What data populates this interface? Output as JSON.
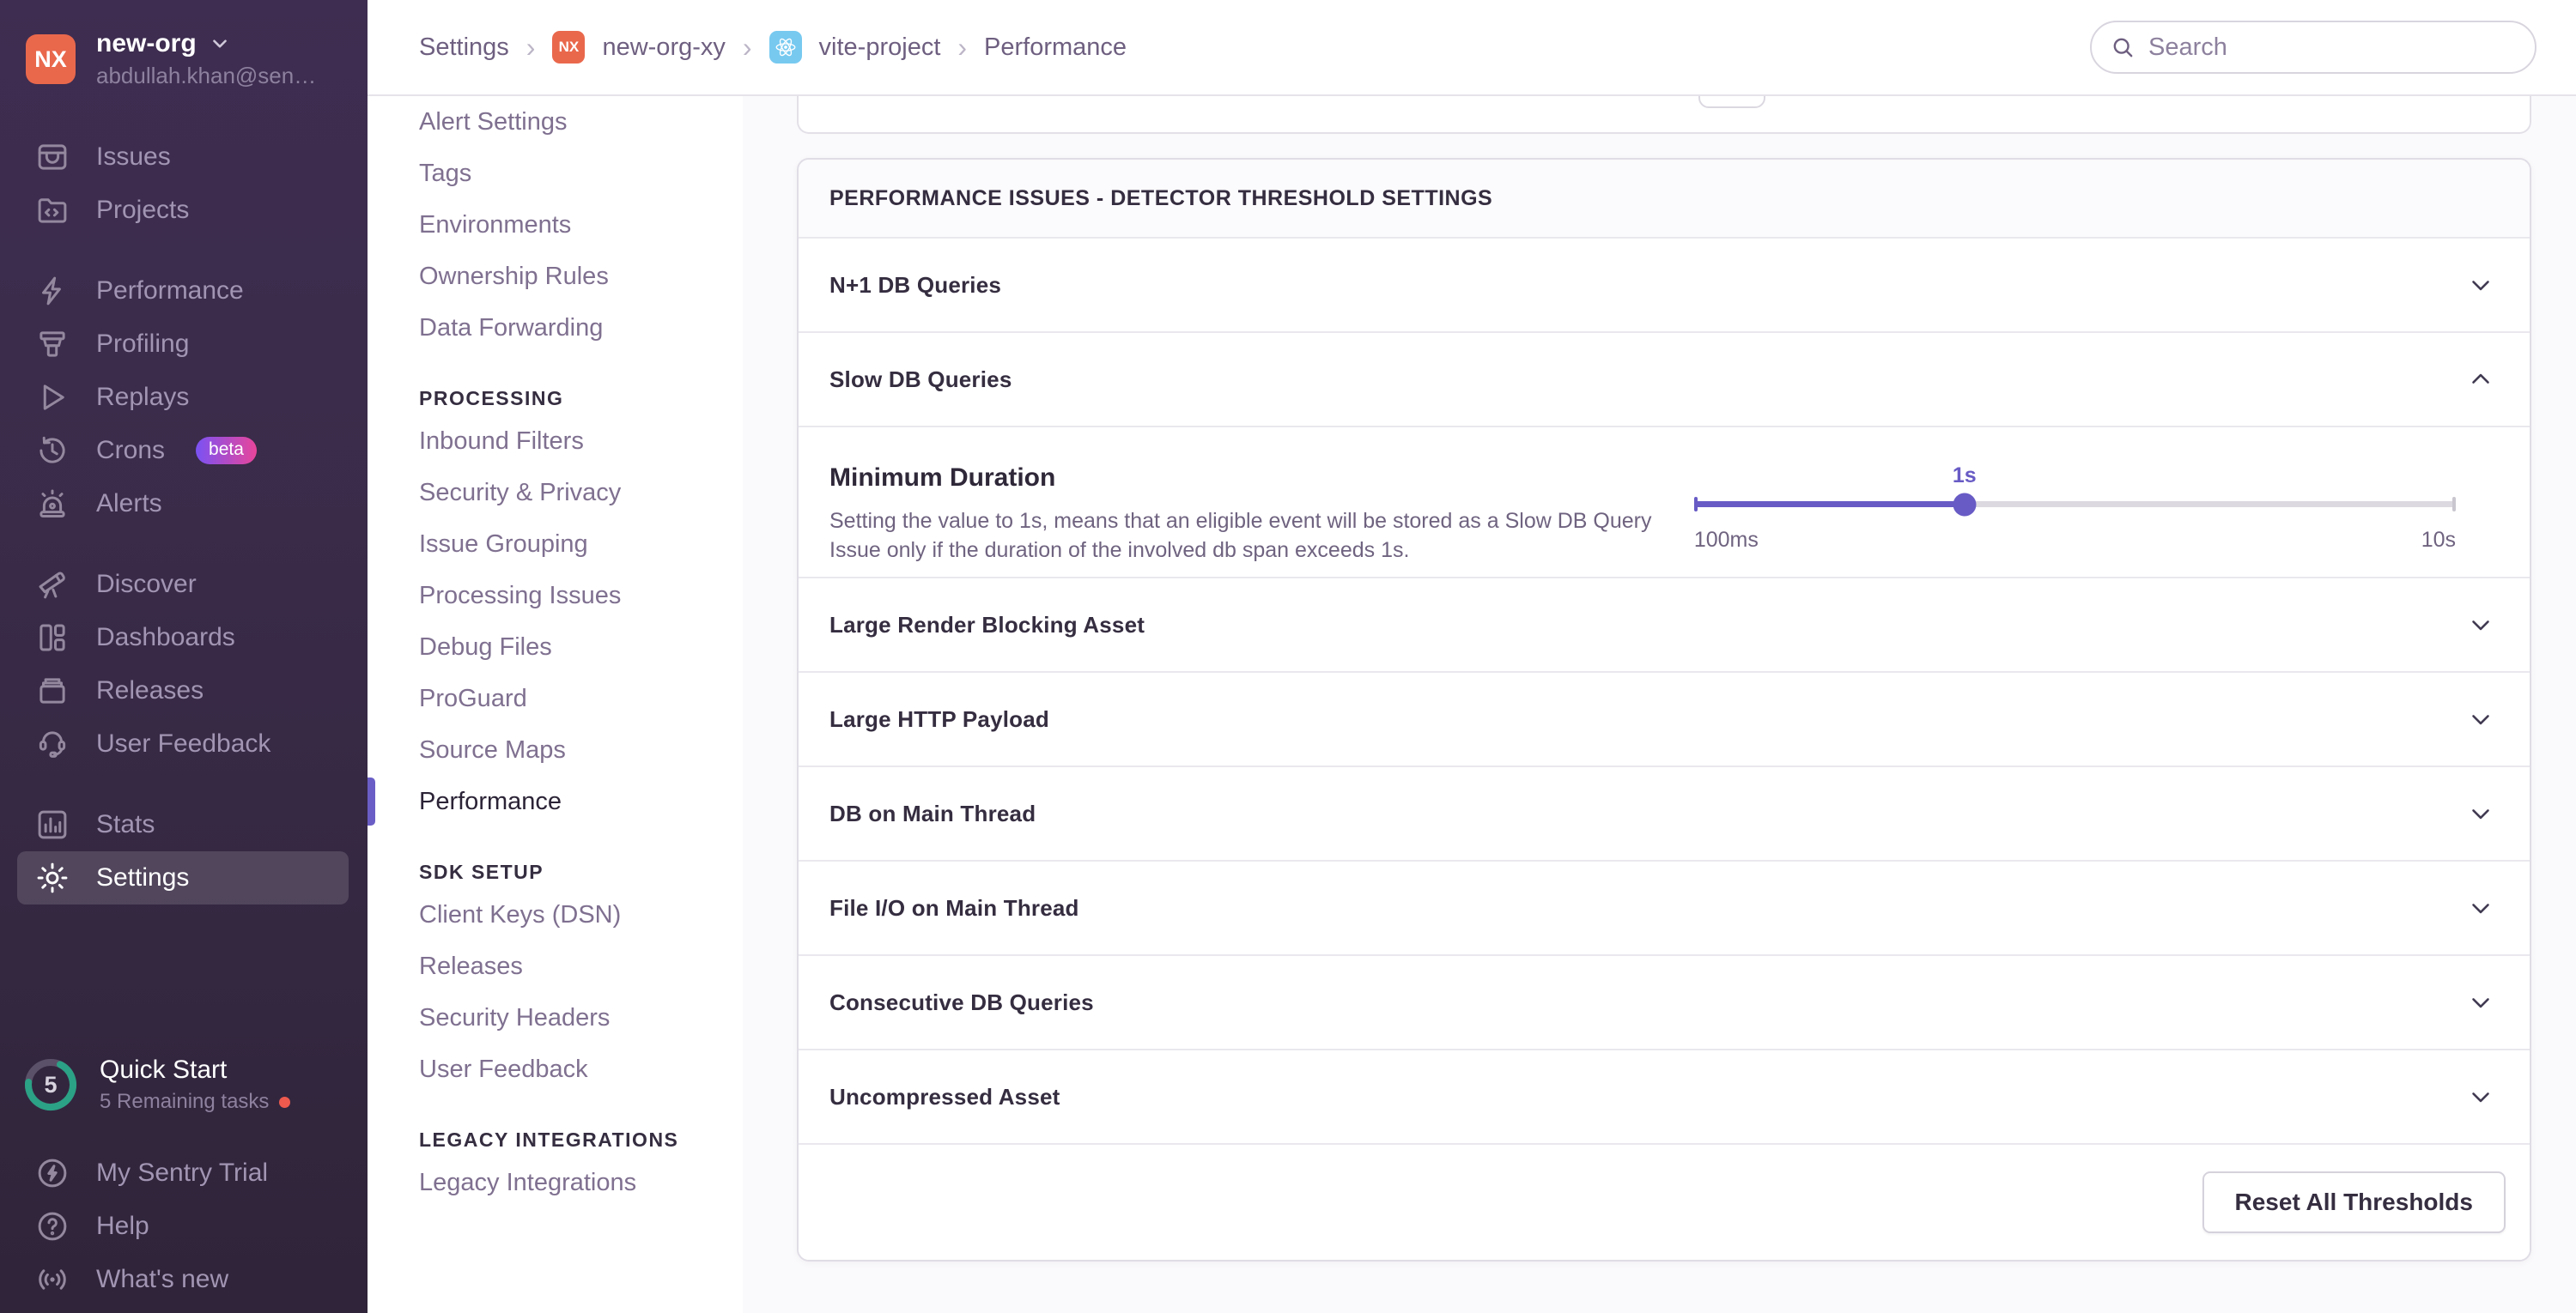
{
  "search": {
    "placeholder": "Search"
  },
  "sidebar": {
    "org": {
      "initials": "NX",
      "name": "new-org",
      "email": "abdullah.khan@sen…"
    },
    "items": [
      {
        "label": "Issues"
      },
      {
        "label": "Projects"
      },
      {
        "label": "Performance"
      },
      {
        "label": "Profiling"
      },
      {
        "label": "Replays"
      },
      {
        "label": "Crons",
        "badge": "beta"
      },
      {
        "label": "Alerts"
      },
      {
        "label": "Discover"
      },
      {
        "label": "Dashboards"
      },
      {
        "label": "Releases"
      },
      {
        "label": "User Feedback"
      },
      {
        "label": "Stats"
      },
      {
        "label": "Settings"
      }
    ],
    "active_item": "Settings",
    "quickstart": {
      "count": "5",
      "title": "Quick Start",
      "subtitle": "5 Remaining tasks"
    },
    "footer_items": [
      "My Sentry Trial",
      "Help",
      "What's new"
    ]
  },
  "settings_nav": {
    "top_items": [
      "Alert Settings",
      "Tags",
      "Environments",
      "Ownership Rules",
      "Data Forwarding"
    ],
    "sections": [
      {
        "header": "PROCESSING",
        "items": [
          "Inbound Filters",
          "Security & Privacy",
          "Issue Grouping",
          "Processing Issues",
          "Debug Files",
          "ProGuard",
          "Source Maps",
          "Performance"
        ]
      },
      {
        "header": "SDK SETUP",
        "items": [
          "Client Keys (DSN)",
          "Releases",
          "Security Headers",
          "User Feedback"
        ]
      },
      {
        "header": "LEGACY INTEGRATIONS",
        "items": [
          "Legacy Integrations"
        ]
      }
    ],
    "active_item": "Performance"
  },
  "breadcrumb": {
    "items": [
      "Settings",
      "new-org-xy",
      "vite-project",
      "Performance"
    ],
    "org_initials": "NX"
  },
  "panel": {
    "title": "PERFORMANCE ISSUES - DETECTOR THRESHOLD SETTINGS",
    "rows": [
      {
        "label": "N+1 DB Queries",
        "state": "collapsed"
      },
      {
        "label": "Slow DB Queries",
        "state": "expanded"
      },
      {
        "label": "Large Render Blocking Asset",
        "state": "collapsed"
      },
      {
        "label": "Large HTTP Payload",
        "state": "collapsed"
      },
      {
        "label": "DB on Main Thread",
        "state": "collapsed"
      },
      {
        "label": "File I/O on Main Thread",
        "state": "collapsed"
      },
      {
        "label": "Consecutive DB Queries",
        "state": "collapsed"
      },
      {
        "label": "Uncompressed Asset",
        "state": "collapsed"
      }
    ],
    "expanded": {
      "field_label": "Minimum Duration",
      "description": "Setting the value to 1s, means that an eligible event will be stored as a Slow DB Query Issue only if the duration of the involved db span exceeds 1s.",
      "slider": {
        "value_label": "1s",
        "min_label": "100ms",
        "max_label": "10s",
        "percent": 35.5,
        "value_style": "left:35.5%",
        "fill_style": "width:35.5%",
        "handle_style": "left:35.5%"
      }
    },
    "footer_button": "Reset All Thresholds"
  },
  "colors": {
    "accent_purple": "#685bc5",
    "sidebar_bg_top": "#3f2d51",
    "sidebar_bg_bottom": "#2f2439",
    "org_avatar_orange": "#e9684c",
    "beta_gradient_start": "#7a52f4",
    "beta_gradient_end": "#e8459a",
    "quickstart_ring_green": "#2ba185",
    "notification_dot_red": "#ee5a4e",
    "react_badge_blue": "#77c9f0"
  }
}
